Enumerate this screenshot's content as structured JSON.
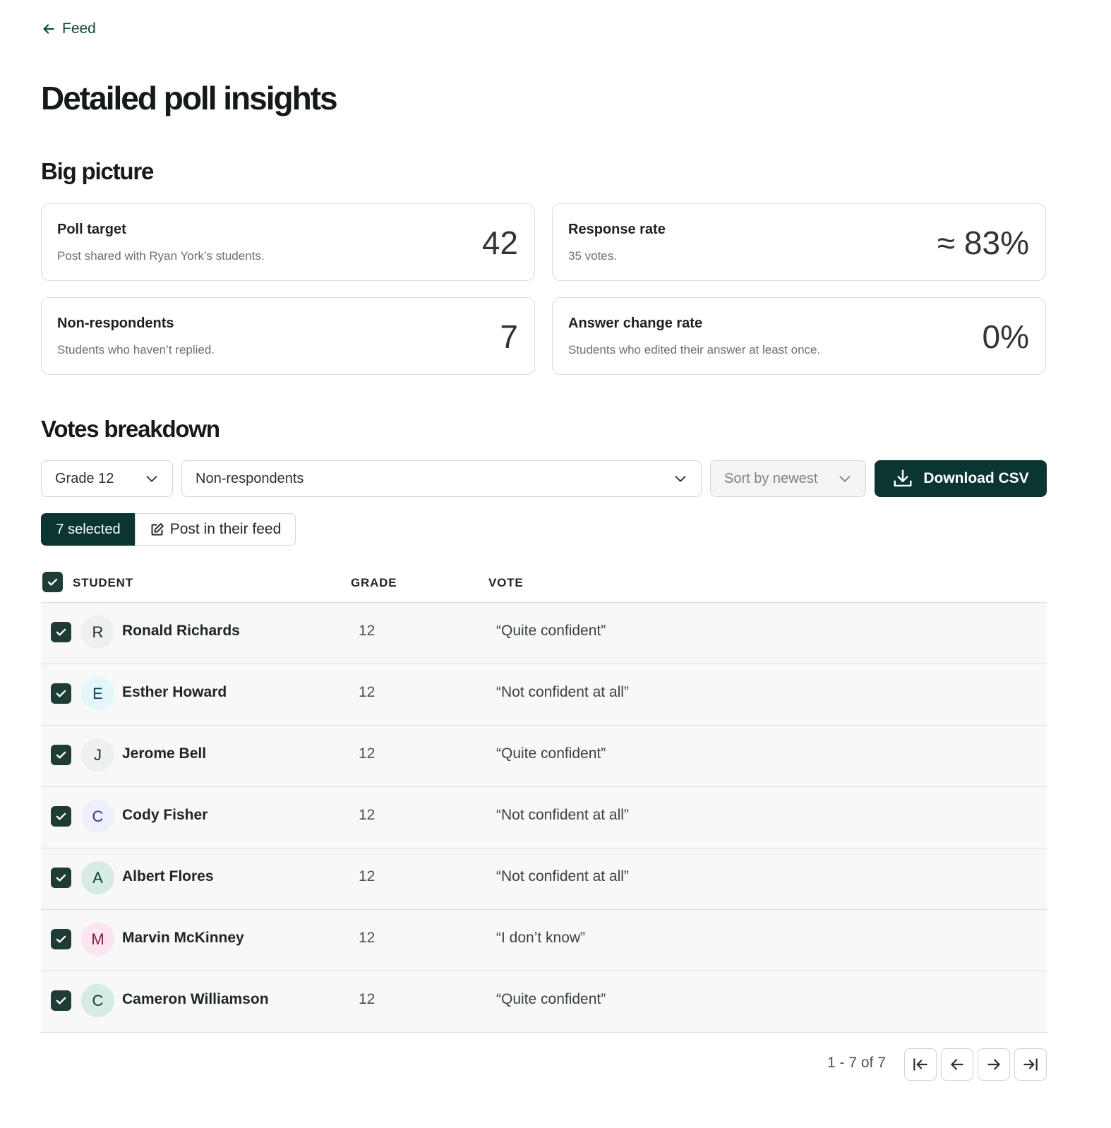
{
  "nav": {
    "back_label": "Feed"
  },
  "page_title": "Detailed poll insights",
  "big_picture": {
    "title": "Big picture",
    "cards": [
      {
        "label": "Poll target",
        "description": "Post shared with Ryan York’s students.",
        "value": "42"
      },
      {
        "label": "Response rate",
        "description": "35 votes.",
        "value": "≈ 83%"
      },
      {
        "label": "Non-respondents",
        "description": "Students who haven’t replied.",
        "value": "7"
      },
      {
        "label": "Answer change rate",
        "description": "Students who edited their answer at least once.",
        "value": "0%"
      }
    ]
  },
  "votes": {
    "title": "Votes breakdown",
    "filters": {
      "grade": "Grade 12",
      "group": "Non-respondents",
      "sort": "Sort by newest"
    },
    "download_label": "Download CSV",
    "selection": {
      "count_label": "7 selected",
      "post_label": "Post in their feed"
    },
    "columns": {
      "student": "STUDENT",
      "grade": "GRADE",
      "vote": "VOTE"
    },
    "rows": [
      {
        "initial": "R",
        "name": "Ronald Richards",
        "grade": "12",
        "vote": "“Quite confident”",
        "avatar_bg": "#eef0ef",
        "avatar_fg": "#1f2a27"
      },
      {
        "initial": "E",
        "name": "Esther Howard",
        "grade": "12",
        "vote": "“Not confident at all”",
        "avatar_bg": "#e3f6fb",
        "avatar_fg": "#0e4a5a"
      },
      {
        "initial": "J",
        "name": "Jerome Bell",
        "grade": "12",
        "vote": "“Quite confident”",
        "avatar_bg": "#eef0ef",
        "avatar_fg": "#1f2a27"
      },
      {
        "initial": "C",
        "name": "Cody Fisher",
        "grade": "12",
        "vote": "“Not confident at all”",
        "avatar_bg": "#eeeffb",
        "avatar_fg": "#2d3a8c"
      },
      {
        "initial": "A",
        "name": "Albert Flores",
        "grade": "12",
        "vote": "“Not confident at all”",
        "avatar_bg": "#d6ece3",
        "avatar_fg": "#14392f"
      },
      {
        "initial": "M",
        "name": "Marvin McKinney",
        "grade": "12",
        "vote": "“I don’t know”",
        "avatar_bg": "#fbe5f1",
        "avatar_fg": "#8a1650"
      },
      {
        "initial": "C",
        "name": "Cameron Williamson",
        "grade": "12",
        "vote": "“Quite confident”",
        "avatar_bg": "#d6ece3",
        "avatar_fg": "#14392f"
      }
    ],
    "pagination": {
      "label": "1 - 7 of 7"
    }
  },
  "colors": {
    "accent": "#0b3530",
    "checkbox": "#1e3b36",
    "row_bg": "#f7f8f7",
    "border": "#d9dddb"
  }
}
